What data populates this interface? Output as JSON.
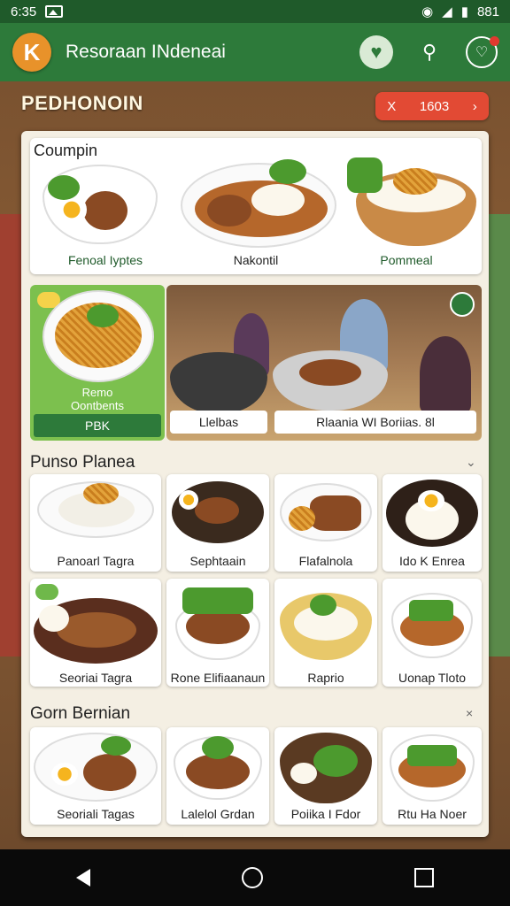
{
  "status_bar": {
    "time": "6:35",
    "right_text": "881"
  },
  "app_bar": {
    "title": "Resoraan INdeneai",
    "back_glyph": "K"
  },
  "header": {
    "title": "PEDHONOIN",
    "pill_prefix": "X",
    "pill_value": "1603"
  },
  "top_section": {
    "title": "Coumpin",
    "items": [
      {
        "label": "Fenoal Iyptes"
      },
      {
        "label": "Nakontil"
      },
      {
        "label": "Pommeal"
      }
    ]
  },
  "featured": {
    "line1": "Remo",
    "line2": "Oontbents",
    "button": "PBK"
  },
  "photo_labels": [
    "Llelbas",
    "Rlaania  WI Boriias.  8l"
  ],
  "section2": {
    "title": "Punso Planea",
    "items": [
      {
        "label": "Panoarl Tagra"
      },
      {
        "label": "Sephtaain"
      },
      {
        "label": "Flafalnola"
      },
      {
        "label": "Ido K Enrea"
      },
      {
        "label": "Seoriai Tagra"
      },
      {
        "label": "Rone Elifiaanaun"
      },
      {
        "label": "Raprio"
      },
      {
        "label": "Uonap Tloto"
      }
    ]
  },
  "section3": {
    "title": "Gorn Bernian",
    "items": [
      {
        "label": "Seoriali Tagas"
      },
      {
        "label": "Lalelol Grdan"
      },
      {
        "label": "Poiika I Fdor"
      },
      {
        "label": "Rtu Ha Noer"
      }
    ]
  },
  "icons": [
    "back-icon",
    "heart-icon",
    "share-icon",
    "notification-icon",
    "chevron-down-icon",
    "close-icon",
    "check-icon"
  ],
  "colors": {
    "appbar": "#2d7a3a",
    "accent": "#e8922a",
    "pill": "#e24a34",
    "featured": "#7cc04e"
  }
}
